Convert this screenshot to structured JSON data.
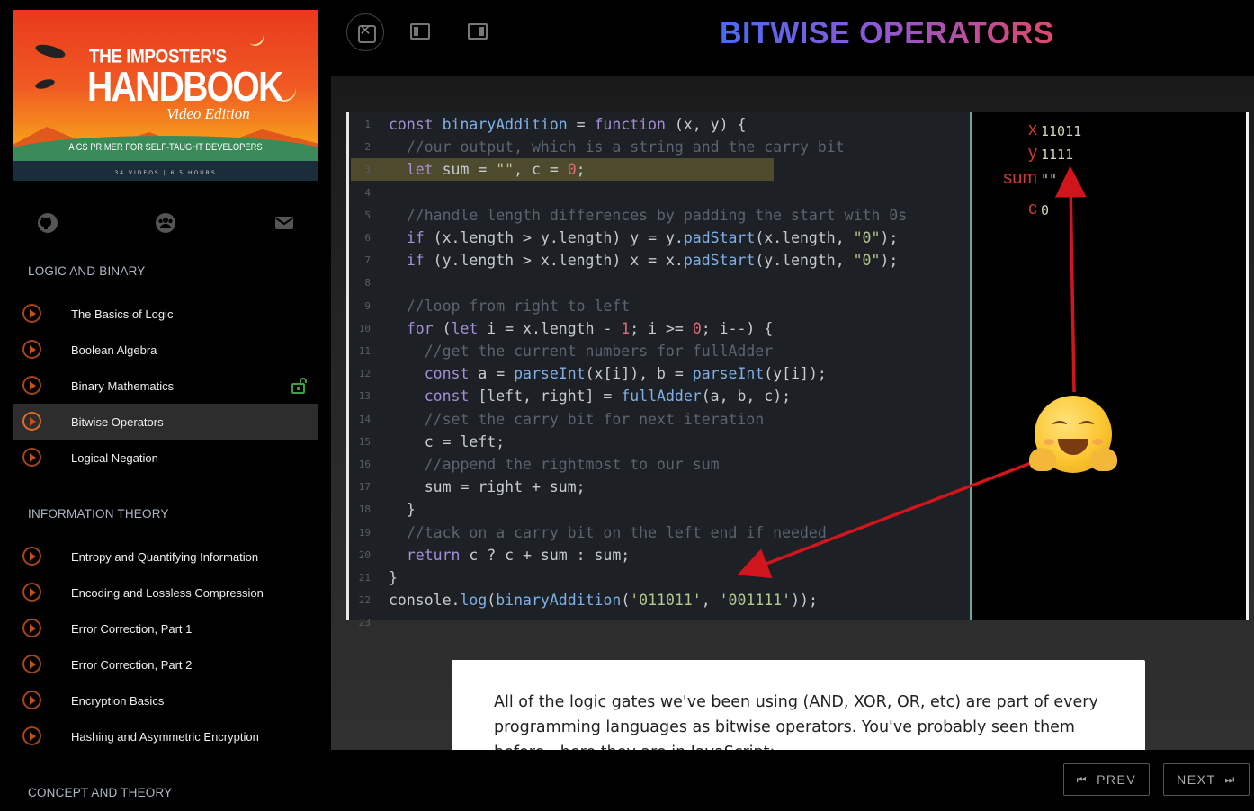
{
  "cover": {
    "title_line1": "THE IMPOSTER'S",
    "title_line2": "HANDBOOK",
    "title_line3": "Video Edition",
    "subtitle": "A CS PRIMER FOR SELF-TAUGHT DEVELOPERS",
    "meta": "34 VIDEOS | 6.5 HOURS"
  },
  "social": [
    "github-icon",
    "community-icon",
    "mail-icon"
  ],
  "sections": [
    {
      "title": "LOGIC AND BINARY",
      "items": [
        {
          "label": "The Basics of Logic"
        },
        {
          "label": "Boolean Algebra"
        },
        {
          "label": "Binary Mathematics",
          "unlocked": true
        },
        {
          "label": "Bitwise Operators",
          "active": true
        },
        {
          "label": "Logical Negation"
        }
      ]
    },
    {
      "title": "INFORMATION THEORY",
      "items": [
        {
          "label": "Entropy and Quantifying Information"
        },
        {
          "label": "Encoding and Lossless Compression"
        },
        {
          "label": "Error Correction, Part 1"
        },
        {
          "label": "Error Correction, Part 2"
        },
        {
          "label": "Encryption Basics"
        },
        {
          "label": "Hashing and Asymmetric Encryption"
        }
      ]
    },
    {
      "title": "CONCEPT AND THEORY",
      "items": []
    }
  ],
  "page_title": "BITWISE OPERATORS",
  "code": {
    "line_numbers": [
      "1",
      "2",
      "3",
      "4",
      "5",
      "6",
      "7",
      "8",
      "9",
      "10",
      "11",
      "12",
      "13",
      "14",
      "15",
      "16",
      "17",
      "18",
      "19",
      "20",
      "21",
      "22",
      "23"
    ],
    "lines": [
      "const binaryAddition = function (x, y) {",
      "  //our output, which is a string and the carry bit",
      "  let sum = \"\", c = 0;",
      "",
      "  //handle length differences by padding the start with 0s",
      "  if (x.length > y.length) y = y.padStart(x.length, \"0\");",
      "  if (y.length > x.length) x = x.padStart(y.length, \"0\");",
      "",
      "  //loop from right to left",
      "  for (let i = x.length - 1; i >= 0; i--) {",
      "    //get the current numbers for fullAdder",
      "    const a = parseInt(x[i]), b = parseInt(y[i]);",
      "    const [left, right] = fullAdder(a, b, c);",
      "    //set the carry bit for next iteration",
      "    c = left;",
      "    //append the rightmost to our sum",
      "    sum = right + sum;",
      "  }",
      "  //tack on a carry bit on the left end if needed",
      "  return c ? c + sum : sum;",
      "}",
      "console.log(binaryAddition('011011', '001111'));",
      ""
    ],
    "highlight_line": 3
  },
  "variables": [
    {
      "name": "x",
      "value": "11011"
    },
    {
      "name": "y",
      "value": "1111"
    },
    {
      "name": "sum",
      "value": "\"\""
    },
    {
      "name": "c",
      "value": "0"
    }
  ],
  "card_text": "All of the logic gates we've been using (AND, XOR, OR, etc) are part of every programming languages as bitwise operators. You've probably seen them before - here they are in JavaScript:",
  "nav": {
    "prev_label": "PREV",
    "next_label": "NEXT"
  },
  "colors": {
    "accent": "#e06a2a",
    "title_start": "#4a6cf0",
    "title_end": "#e0486a",
    "arrow": "#d0161c"
  }
}
